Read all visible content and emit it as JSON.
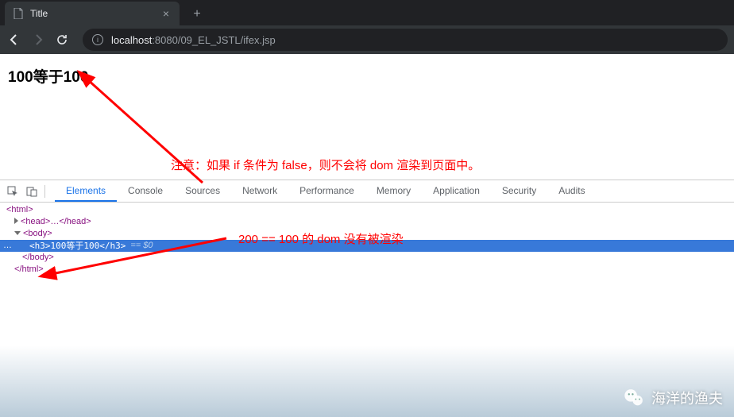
{
  "browser": {
    "tab_title": "Title",
    "url_host": "localhost",
    "url_path": ":8080/09_EL_JSTL/ifex.jsp"
  },
  "page": {
    "heading": "100等于100"
  },
  "annotations": {
    "note1": "注意：如果 if 条件为 false，则不会将 dom 渲染到页面中。",
    "note2": "200 == 100 的 dom 没有被渲染"
  },
  "devtools": {
    "tabs": {
      "elements": "Elements",
      "console": "Console",
      "sources": "Sources",
      "network": "Network",
      "performance": "Performance",
      "memory": "Memory",
      "application": "Application",
      "security": "Security",
      "audits": "Audits"
    },
    "dom": {
      "html_open": "<html>",
      "head": "<head>…</head>",
      "body_open": "<body>",
      "selected_outer": "<h3>100等于100</h3>",
      "selected_marker": "== $0",
      "body_close": "</body>",
      "html_close": "</html>"
    }
  },
  "watermark": {
    "text": "海洋的渔夫"
  }
}
